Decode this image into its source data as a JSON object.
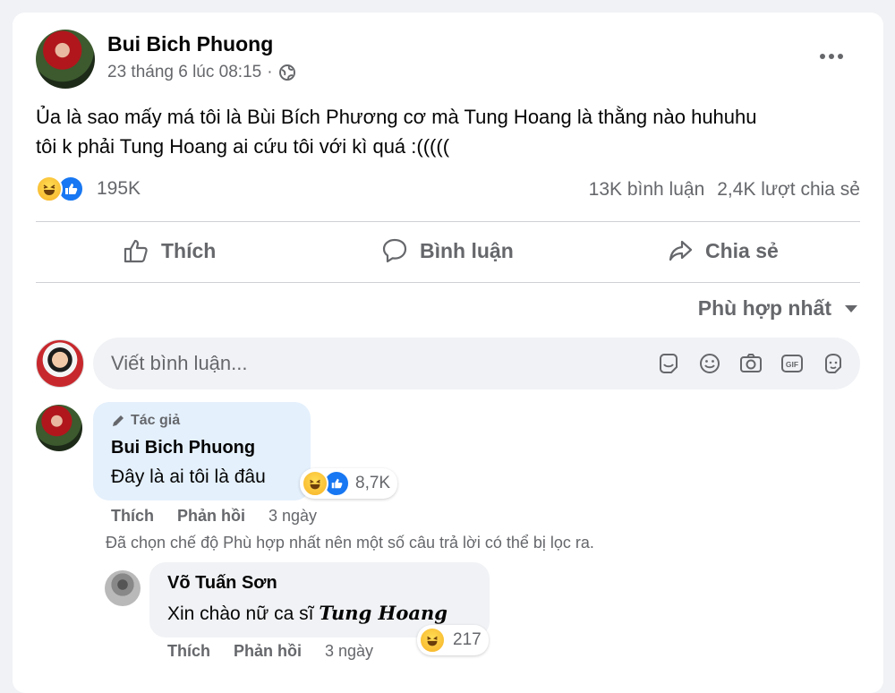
{
  "post": {
    "author": "Bui Bich Phuong",
    "timestamp": "23 tháng 6 lúc 08:15",
    "separator": "·",
    "text_line1": "Ủa là sao mấy má tôi là Bùi Bích Phương cơ mà Tung Hoang là thằng nào huhuhu",
    "text_line2": "tôi k phải Tung Hoang ai cứu tôi với kì quá :(((((",
    "reaction_count": "195K",
    "comment_count": "13K bình luận",
    "share_count": "2,4K lượt chia sẻ"
  },
  "actions": {
    "like": "Thích",
    "comment": "Bình luận",
    "share": "Chia sẻ"
  },
  "sort": {
    "label": "Phù hợp nhất"
  },
  "composer": {
    "placeholder": "Viết bình luận..."
  },
  "comments": [
    {
      "badge": "Tác giả",
      "name": "Bui Bich Phuong",
      "text": "Đây là ai tôi là đâu",
      "reactions": "8,7K",
      "like": "Thích",
      "reply": "Phản hồi",
      "time": "3 ngày"
    }
  ],
  "filter_note": "Đã chọn chế độ Phù hợp nhất nên một số câu trả lời có thể bị lọc ra.",
  "reply": {
    "name": "Võ Tuấn Sơn",
    "text_prefix": "Xin chào nữ ca sĩ",
    "text_styled": "Tung Hoang",
    "reactions": "217",
    "like": "Thích",
    "reply": "Phản hồi",
    "time": "3 ngày"
  },
  "colors": {
    "accent": "#1877f2",
    "author_bubble": "#e4f0fc",
    "bubble": "#f0f2f5",
    "muted": "#65676b"
  },
  "icons": [
    "globe-icon",
    "more-icon",
    "like-icon",
    "comment-icon",
    "share-icon",
    "caret-down-icon",
    "sticker-icon",
    "emoji-icon",
    "camera-icon",
    "gif-icon",
    "avatar-sticker-icon",
    "pen-icon",
    "haha-reaction-icon",
    "like-reaction-icon"
  ]
}
